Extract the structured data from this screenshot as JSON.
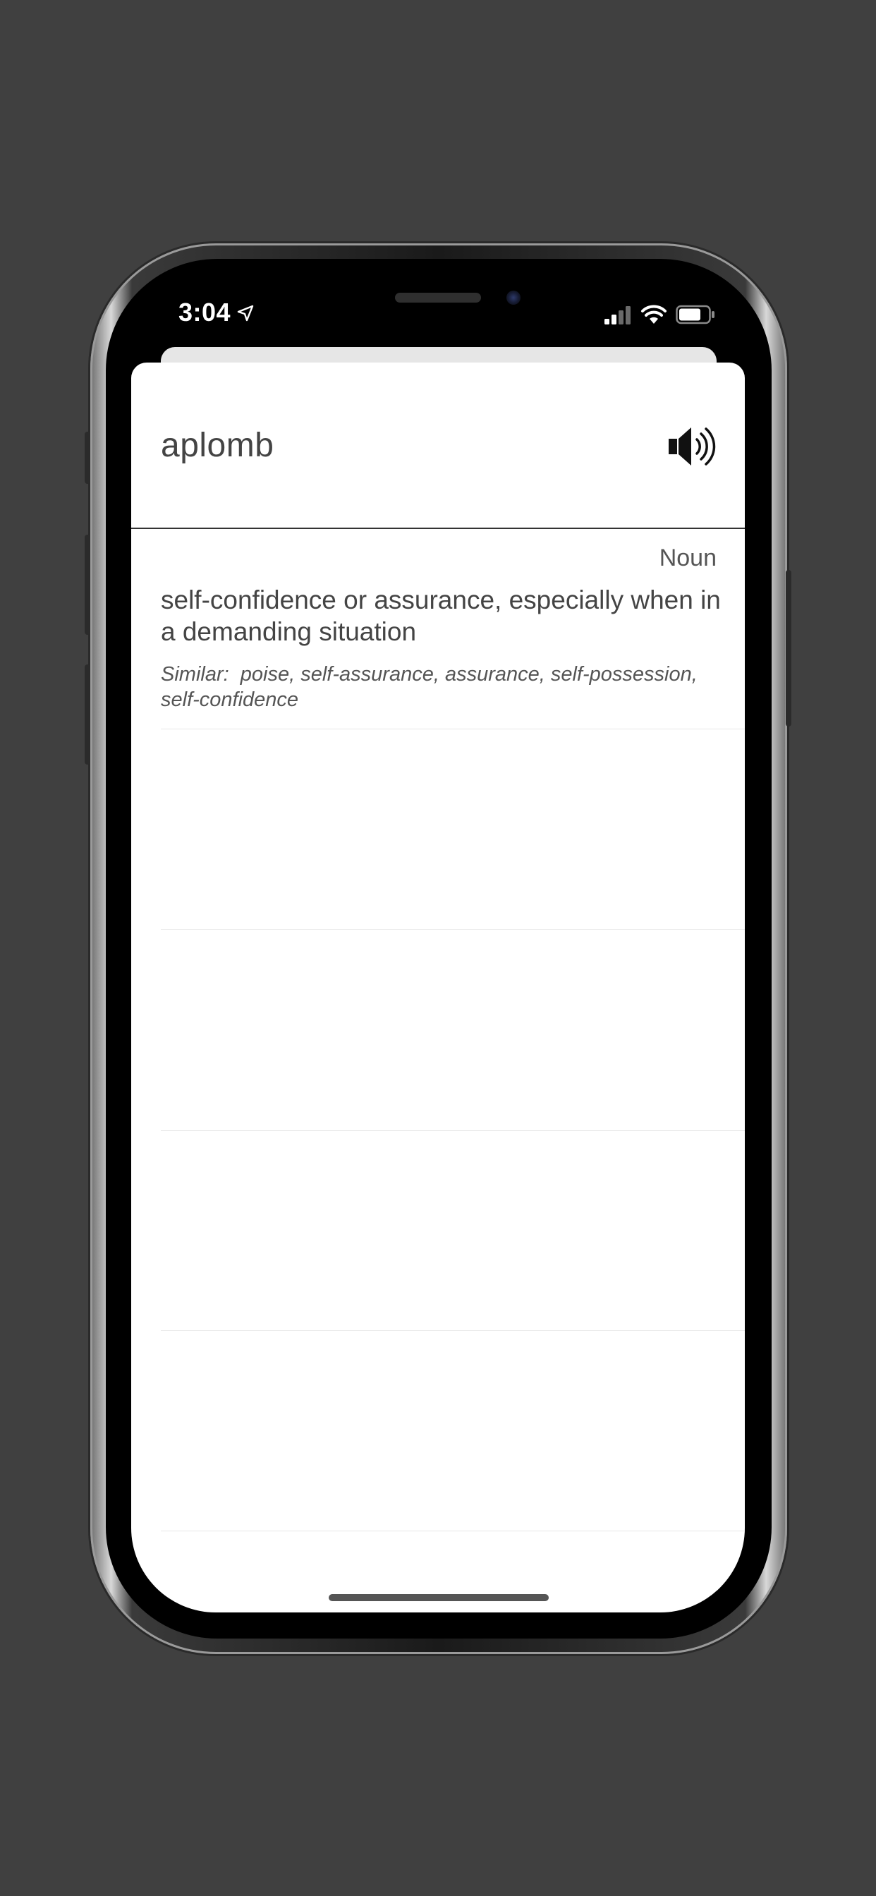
{
  "status_bar": {
    "time": "3:04",
    "location_icon": "location-arrow-icon",
    "signal_icon": "cellular-signal-icon",
    "wifi_icon": "wifi-icon",
    "battery_icon": "battery-icon"
  },
  "entry": {
    "word": "aplomb",
    "speaker_icon": "speaker-volume-icon"
  },
  "senses": [
    {
      "part_of_speech": "Noun",
      "definition": "self-confidence or assurance, especially when in a demanding situation",
      "similar_label": "Similar:",
      "similar_words": "poise, self-assurance, assurance, self-possession, self-confidence"
    }
  ],
  "colors": {
    "background": "#404040",
    "card": "#ffffff",
    "text": "#444444",
    "divider": "#333333"
  }
}
